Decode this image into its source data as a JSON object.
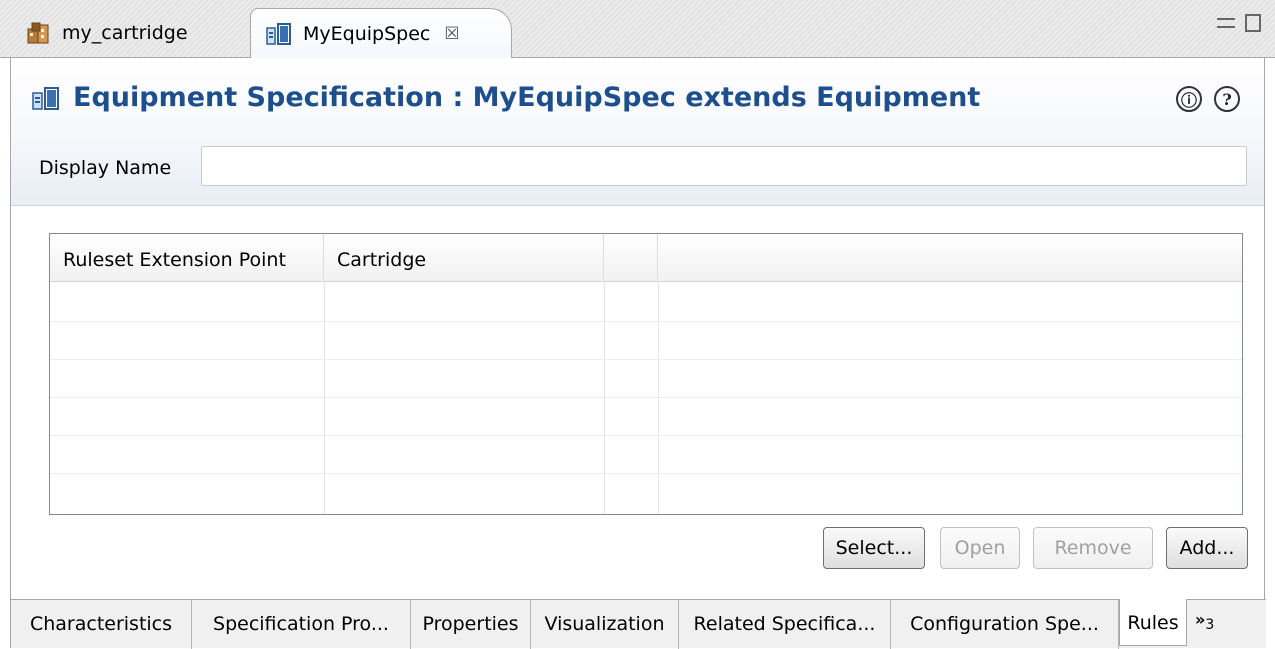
{
  "editor_tabs": [
    {
      "label": "my_cartridge",
      "icon": "cartridge-icon",
      "active": false
    },
    {
      "label": "MyEquipSpec",
      "icon": "equipment-icon",
      "active": true,
      "close": "☒"
    }
  ],
  "header": {
    "title": "Equipment Specification : MyEquipSpec extends Equipment",
    "info_icon": "ⓘ",
    "help_icon": "?",
    "display_name_label": "Display Name",
    "display_name_value": ""
  },
  "table": {
    "columns": [
      "Ruleset Extension Point",
      "Cartridge",
      "",
      ""
    ],
    "rows": []
  },
  "actions": {
    "select": "Select...",
    "open": "Open",
    "remove": "Remove",
    "add": "Add..."
  },
  "page_tabs": [
    "Characteristics",
    "Specification Pro...",
    "Properties",
    "Visualization",
    "Related Specifica...",
    "Configuration Spe...",
    "Rules"
  ],
  "active_page_tab": "Rules",
  "overflow": {
    "chevron": "»",
    "count": "3"
  }
}
